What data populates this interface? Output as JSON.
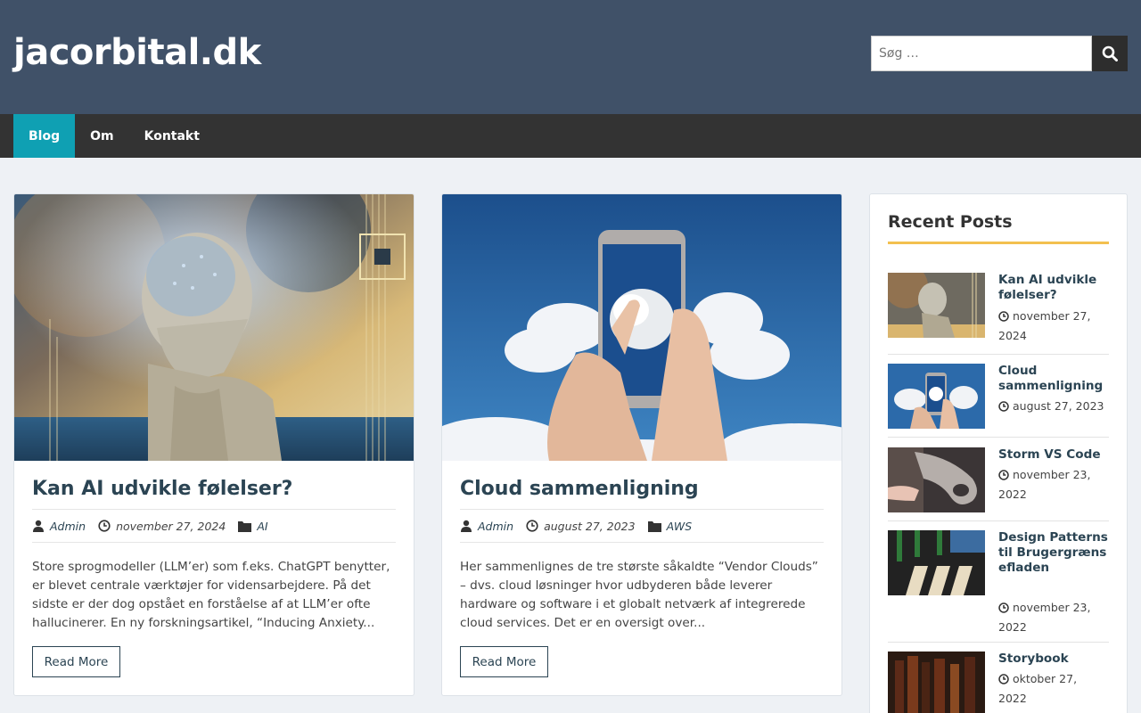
{
  "site": {
    "title": "jacorbital.dk"
  },
  "search": {
    "placeholder": "Søg …"
  },
  "nav": {
    "items": [
      "Blog",
      "Om",
      "Kontakt"
    ]
  },
  "posts": [
    {
      "title": "Kan AI udvikle følelser?",
      "author": "Admin",
      "date": "november 27, 2024",
      "category": "AI",
      "excerpt": "Store sprogmodeller (LLM’er) som f.eks. ChatGPT benytter, er blevet centrale værktøjer for vidensarbejdere. På det sidste er der dog opstået en forståelse af at LLM’er ofte hallucinerer. En ny forskningsartikel, “Inducing Anxiety...",
      "read_more": "Read More"
    },
    {
      "title": "Cloud sammenligning",
      "author": "Admin",
      "date": "august 27, 2023",
      "category": "AWS",
      "excerpt": "Her sammenlignes de tre største såkaldte “Vendor Clouds” – dvs. cloud løsninger hvor udbyderen både leverer hardware og software i et globalt netværk af integrerede cloud services. Det er en oversigt over...",
      "read_more": "Read More"
    }
  ],
  "sidebar": {
    "title": "Recent Posts",
    "items": [
      {
        "title": "Kan AI udvikle følelser?",
        "date": "november 27, 2024"
      },
      {
        "title": "Cloud sammenligning",
        "date": "august 27, 2023"
      },
      {
        "title": "Storm VS Code",
        "date": "november 23, 2022"
      },
      {
        "title": "Design Patterns til Brugergrænsefladen",
        "date": "november 23, 2022"
      },
      {
        "title": "Storybook",
        "date": "oktober 27, 2022"
      }
    ]
  },
  "colors": {
    "header": "#405168",
    "nav": "#333333",
    "nav_active": "#0fa0b3",
    "accent": "#f3c04f",
    "link": "#2b4453"
  }
}
